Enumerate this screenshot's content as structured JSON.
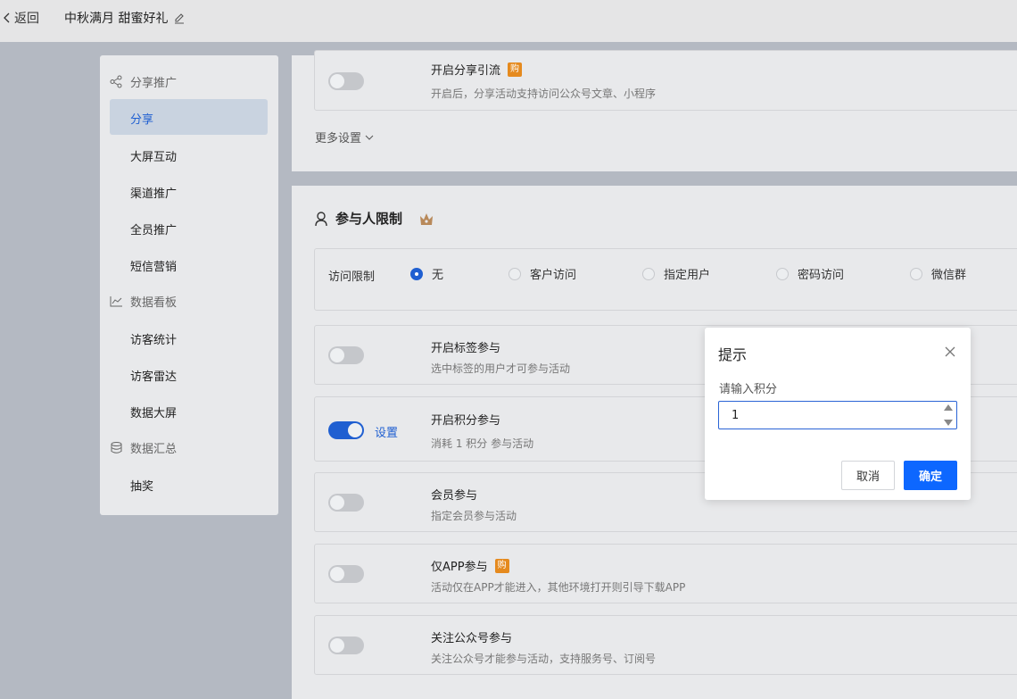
{
  "topbar": {
    "back_label": "返回",
    "title": "中秋满月 甜蜜好礼"
  },
  "sidebar": {
    "groups": [
      {
        "label": "分享推广",
        "items": [
          "分享",
          "大屏互动",
          "渠道推广",
          "全员推广",
          "短信营销"
        ]
      },
      {
        "label": "数据看板",
        "items": [
          "访客统计",
          "访客雷达",
          "数据大屏"
        ]
      },
      {
        "label": "数据汇总",
        "items": [
          "抽奖"
        ]
      }
    ],
    "active_item": "分享"
  },
  "share_card": {
    "share_traffic": {
      "title": "开启分享引流",
      "badge": "购",
      "desc": "开启后，分享活动支持访问公众号文章、小程序",
      "enabled": false
    },
    "more_settings": "更多设置"
  },
  "participant": {
    "section_title": "参与人限制",
    "access": {
      "label": "访问限制",
      "options": [
        "无",
        "客户访问",
        "指定用户",
        "密码访问",
        "微信群"
      ],
      "selected": "无"
    },
    "rows": [
      {
        "title": "开启标签参与",
        "desc": "选中标签的用户才可参与活动",
        "enabled": false
      },
      {
        "title": "开启积分参与",
        "desc": "消耗 1 积分 参与活动",
        "enabled": true,
        "link": "设置"
      },
      {
        "title": "会员参与",
        "desc": "指定会员参与活动",
        "enabled": false
      },
      {
        "title": "仅APP参与",
        "badge": "购",
        "desc": "活动仅在APP才能进入，其他环境打开则引导下载APP",
        "enabled": false
      },
      {
        "title": "关注公众号参与",
        "desc": "关注公众号才能参与活动，支持服务号、订阅号",
        "enabled": false
      }
    ]
  },
  "modal": {
    "title": "提示",
    "label": "请输入积分",
    "value": "1",
    "cancel": "取消",
    "confirm": "确定"
  },
  "colors": {
    "accent": "#1f5fd1",
    "primary_button": "#0d67ff",
    "badge": "#e58a1e"
  }
}
